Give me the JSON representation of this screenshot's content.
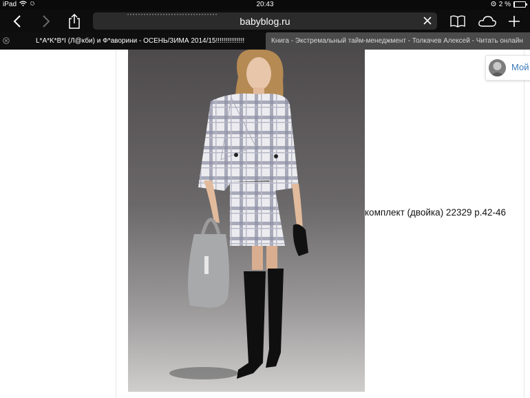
{
  "status_bar": {
    "device": "iPad",
    "time": "20:43",
    "battery_text": "2 %",
    "battery_level": 0.02
  },
  "toolbar": {
    "url": "babyblog.ru",
    "icons": [
      "back-icon",
      "forward-icon",
      "share-icon",
      "clear-icon",
      "bookmarks-icon",
      "icloud-tabs-icon",
      "new-tab-icon"
    ]
  },
  "tabs": [
    {
      "title": "L*A*K*B*I (Л@кби) и Ф*аворини - ОСЕНЬ/ЗИМА 2014/15!!!!!!!!!!!!!!!",
      "active": true
    },
    {
      "title": "Книга - Экстремальный тайм-менеджмент - Толкачев Алексей - Читать онлайн",
      "active": false
    }
  ],
  "content": {
    "caption": "комплект (двойка) 22329 р.42-46",
    "profile_label": "Мой"
  },
  "colors": {
    "chrome_bg": "#0d0d0d",
    "urlbar_bg": "#2b2b2b",
    "inactive_tab_bg": "#4a4a4a",
    "link_blue": "#3a7ab8"
  }
}
